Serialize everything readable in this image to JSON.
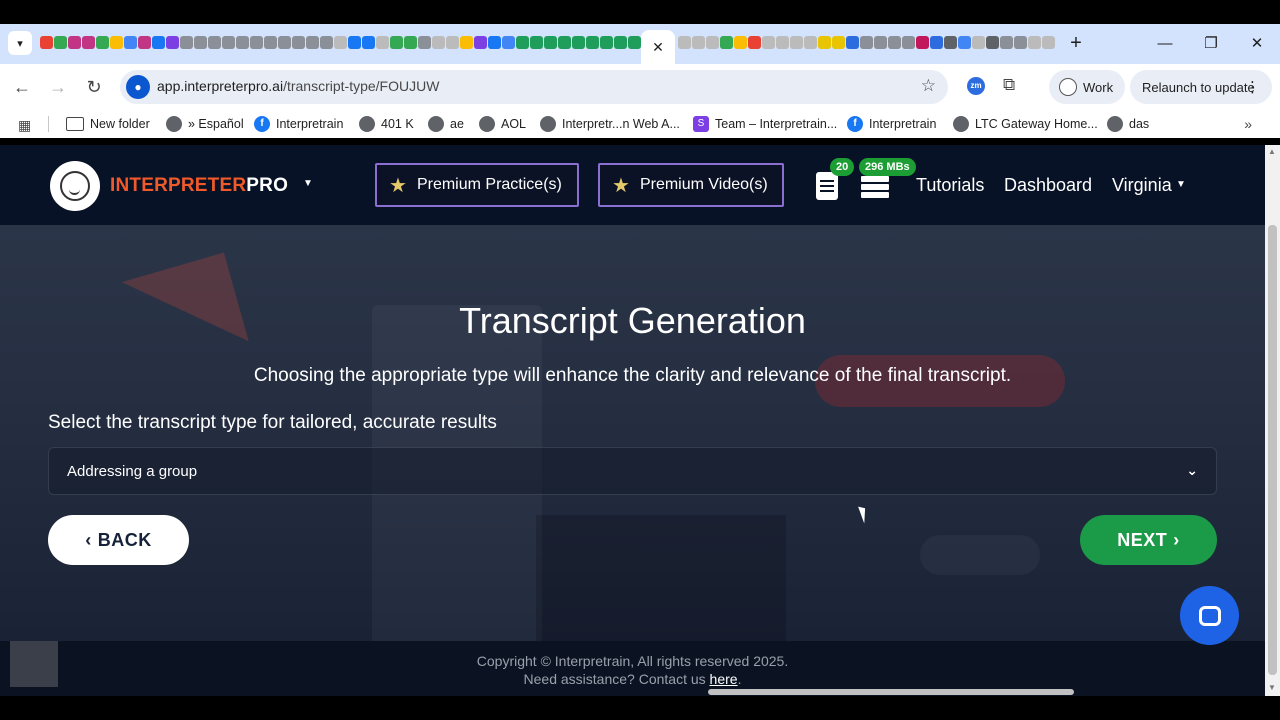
{
  "browser": {
    "url_host": "app.interpreterpro.ai",
    "url_path": "/transcript-type/FOUJUW",
    "profile_label": "Work",
    "relaunch_label": "Relaunch to update",
    "window_controls": [
      "minimize-icon",
      "restore-icon",
      "close-icon"
    ],
    "bookmarks": [
      {
        "label": "New folder",
        "icon": "folder-icon"
      },
      {
        "label": "» Español",
        "icon": "globe-icon"
      },
      {
        "label": "Interpretrain",
        "icon": "facebook-icon"
      },
      {
        "label": "401 K",
        "icon": "globe-icon"
      },
      {
        "label": "ae",
        "icon": "globe-icon"
      },
      {
        "label": "AOL",
        "icon": "globe-icon"
      },
      {
        "label": "Interpretr...n Web A...",
        "icon": "globe-icon"
      },
      {
        "label": "Team – Interpretrain...",
        "icon": "s-icon"
      },
      {
        "label": "Interpretrain",
        "icon": "facebook-icon"
      },
      {
        "label": "LTC Gateway Home...",
        "icon": "globe-icon"
      },
      {
        "label": "das",
        "icon": "globe-icon"
      }
    ]
  },
  "nav": {
    "brand_part1": "INTERPRETER",
    "brand_part2": "PRO",
    "premium_practice": "Premium Practice(s)",
    "premium_video": "Premium Video(s)",
    "transcripts_badge": "20",
    "storage_badge": "296 MBs",
    "tutorials": "Tutorials",
    "dashboard": "Dashboard",
    "user": "Virginia"
  },
  "main": {
    "title": "Transcript Generation",
    "subtitle": "Choosing the appropriate type will enhance the clarity and relevance of the final transcript.",
    "select_label": "Select the transcript type for tailored, accurate results",
    "select_value": "Addressing a group",
    "back_label": "BACK",
    "next_label": "NEXT"
  },
  "footer": {
    "copyright": "Copyright © Interpretrain, All rights reserved 2025.",
    "assist_text": "Need assistance? Contact us ",
    "assist_link": "here",
    "assist_end": "."
  },
  "colors": {
    "brand_orange": "#f0592a",
    "next_green": "#1b9a48",
    "chat_blue": "#1e63e6",
    "badge_green": "#1d9e35"
  }
}
